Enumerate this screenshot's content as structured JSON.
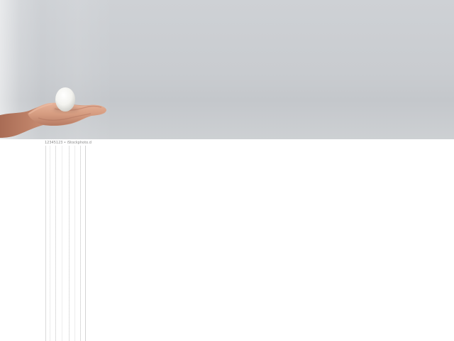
{
  "image": {
    "subject": "hand-holding-egg",
    "colors": {
      "background_gray": "#ccced2",
      "egg_white": "#f5f5f2",
      "skin_tone": "#d9a085"
    }
  },
  "caption": {
    "text": "12345123 • iStockphoto.de"
  }
}
